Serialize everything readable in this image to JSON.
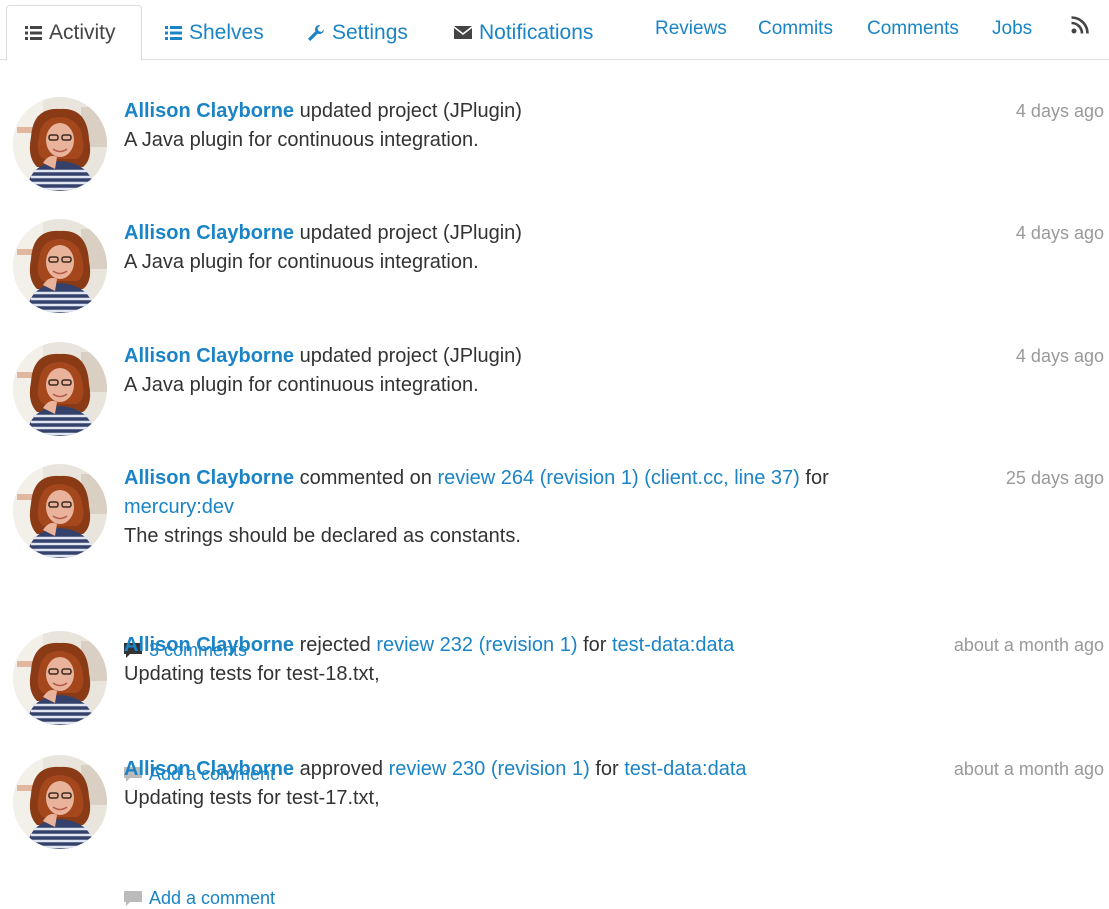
{
  "tabs": [
    {
      "label": "Activity",
      "icon": "list-icon"
    },
    {
      "label": "Shelves",
      "icon": "list-icon"
    },
    {
      "label": "Settings",
      "icon": "wrench-icon"
    },
    {
      "label": "Notifications",
      "icon": "envelope-icon"
    }
  ],
  "filters": [
    "Reviews",
    "Commits",
    "Comments",
    "Jobs"
  ],
  "colors": {
    "link": "#1a84c6",
    "muted": "#999999",
    "text": "#333333"
  },
  "feed": [
    {
      "author": "Allison Clayborne",
      "action": "updated project (JPlugin)",
      "description": "A Java plugin for continuous integration.",
      "time": "4 days ago"
    },
    {
      "author": "Allison Clayborne",
      "action": "updated project (JPlugin)",
      "description": "A Java plugin for continuous integration.",
      "time": "4 days ago"
    },
    {
      "author": "Allison Clayborne",
      "action": "updated project (JPlugin)",
      "description": "A Java plugin for continuous integration.",
      "time": "4 days ago"
    },
    {
      "author": "Allison Clayborne",
      "action": "commented on",
      "target": "review 264 (revision 1) (client.cc, line 37)",
      "for_text": "for",
      "project": "mercury:dev",
      "description": "The strings should be declared as constants.",
      "time": "25 days ago",
      "comments": "3 comments"
    },
    {
      "author": "Allison Clayborne",
      "action": "rejected",
      "target": "review 232 (revision 1)",
      "for_text": "for",
      "project": "test-data:data",
      "description": "Updating tests for test-18.txt,",
      "time": "about a month ago",
      "comments": "Add a comment"
    },
    {
      "author": "Allison Clayborne",
      "action": "approved",
      "target": "review 230 (revision 1)",
      "for_text": "for",
      "project": "test-data:data",
      "description": "Updating tests for test-17.txt,",
      "time": "about a month ago",
      "comments": "Add a comment"
    }
  ]
}
